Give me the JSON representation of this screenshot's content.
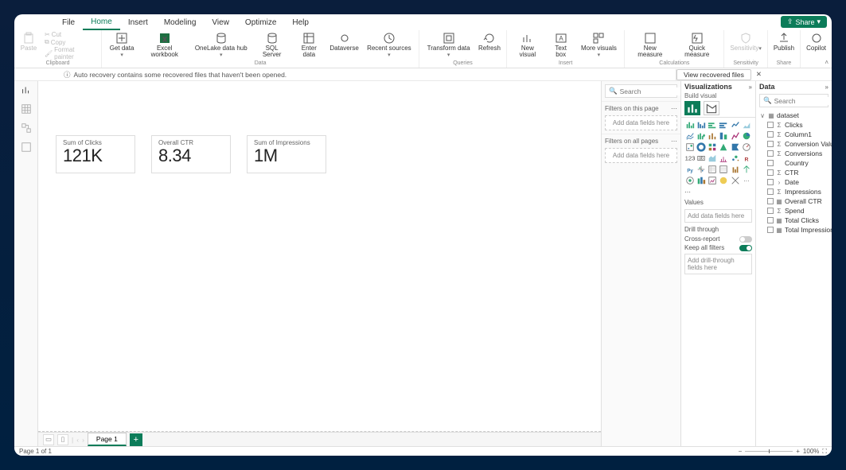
{
  "tabs": [
    "File",
    "Home",
    "Insert",
    "Modeling",
    "View",
    "Optimize",
    "Help"
  ],
  "active_tab": "Home",
  "share_label": "Share",
  "clipboard": {
    "paste": "Paste",
    "cut": "Cut",
    "copy": "Copy",
    "format": "Format painter",
    "group": "Clipboard"
  },
  "data_group": {
    "get": "Get data",
    "get2": "",
    "excel": "Excel workbook",
    "hub": "OneLake data hub",
    "sql": "SQL Server",
    "enter": "Enter data",
    "dataverse": "Dataverse",
    "recent": "Recent sources",
    "group": "Data"
  },
  "queries": {
    "transform": "Transform data",
    "refresh": "Refresh",
    "group": "Queries"
  },
  "insert": {
    "new": "New visual",
    "text": "Text box",
    "more": "More visuals",
    "group": "Insert"
  },
  "calc": {
    "newm": "New measure",
    "quick": "Quick measure",
    "group": "Calculations"
  },
  "sensitivity": {
    "label": "Sensitivity",
    "group": "Sensitivity"
  },
  "shareg": {
    "publish": "Publish",
    "group": "Share"
  },
  "copilot": {
    "label": "Copilot"
  },
  "recovery": {
    "msg": "Auto recovery contains some recovered files that haven't been opened.",
    "btn": "View recovered files"
  },
  "cards": [
    {
      "label": "Sum of Clicks",
      "value": "121K"
    },
    {
      "label": "Overall CTR",
      "value": "8.34"
    },
    {
      "label": "Sum of Impressions",
      "value": "1M"
    }
  ],
  "page_tab": "Page 1",
  "filters": {
    "search_ph": "Search",
    "sec1": "Filters on this page",
    "add1": "Add data fields here",
    "sec2": "Filters on all pages",
    "add2": "Add data fields here"
  },
  "viz": {
    "title": "Visualizations",
    "build": "Build visual",
    "values": "Values",
    "values_ph": "Add data fields here",
    "drill": "Drill through",
    "cross": "Cross-report",
    "keep": "Keep all filters",
    "drill_ph": "Add drill-through fields here"
  },
  "datapane": {
    "title": "Data",
    "search_ph": "Search",
    "table": "dataset",
    "fields": [
      "Clicks",
      "Column1",
      "Conversion Value",
      "Conversions",
      "Country",
      "CTR",
      "Date",
      "Impressions",
      "Overall CTR",
      "Spend",
      "Total Clicks",
      "Total Impressions"
    ]
  },
  "status": {
    "page": "Page 1 of 1",
    "zoom": "100%"
  }
}
